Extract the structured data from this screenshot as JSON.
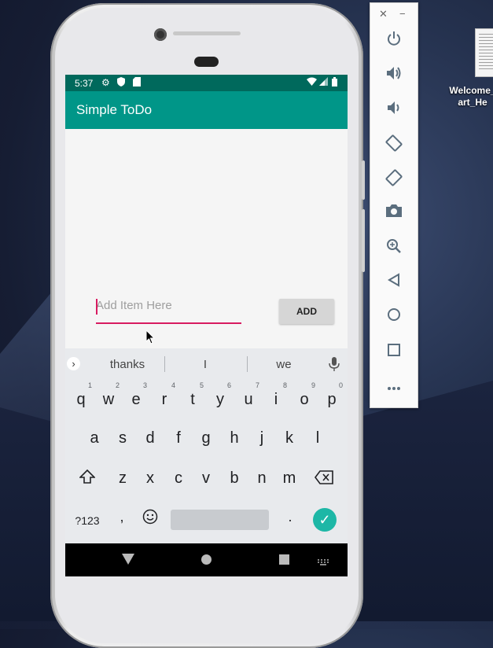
{
  "desktop": {
    "file_label_line1": "Welcome_",
    "file_label_line2": "art_He"
  },
  "status_bar": {
    "time": "5:37"
  },
  "app": {
    "title": "Simple ToDo",
    "input_placeholder": "Add Item Here",
    "input_value": "",
    "add_button_label": "ADD"
  },
  "keyboard": {
    "suggestions": [
      "thanks",
      "I",
      "we"
    ],
    "row1": [
      "q",
      "w",
      "e",
      "r",
      "t",
      "y",
      "u",
      "i",
      "o",
      "p"
    ],
    "row1_hints": [
      "1",
      "2",
      "3",
      "4",
      "5",
      "6",
      "7",
      "8",
      "9",
      "0"
    ],
    "row2": [
      "a",
      "s",
      "d",
      "f",
      "g",
      "h",
      "j",
      "k",
      "l"
    ],
    "row3": [
      "z",
      "x",
      "c",
      "v",
      "b",
      "n",
      "m"
    ],
    "symbols_label": "?123",
    "comma": ",",
    "period": "."
  },
  "emulator_toolbar": {
    "buttons": [
      "power-icon",
      "volume-up-icon",
      "volume-down-icon",
      "rotate-left-icon",
      "rotate-right-icon",
      "camera-icon",
      "zoom-icon",
      "back-icon",
      "home-icon",
      "overview-icon",
      "more-icon"
    ]
  },
  "colors": {
    "status_bar": "#00695c",
    "app_bar": "#009688",
    "accent": "#d81b60",
    "enter_key": "#1db7a6"
  }
}
